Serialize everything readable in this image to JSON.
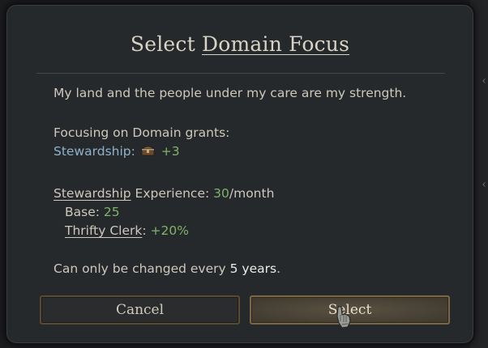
{
  "dialog": {
    "title_prefix": "Select",
    "title_focus": "Domain Focus",
    "description": "My land and the people under my care are my strength.",
    "grants_heading": "Focusing on Domain grants:",
    "grant_skill": "Stewardship",
    "grant_colon": ":",
    "grant_value": "+3",
    "experience": {
      "skill": "Stewardship",
      "label": " Experience: ",
      "value": "30",
      "unit": "/month"
    },
    "base": {
      "label": "Base: ",
      "value": "25"
    },
    "modifier": {
      "name": "Thrifty Clerk",
      "colon": ": ",
      "value": "+20%"
    },
    "change_note_prefix": "Can only be changed every ",
    "change_note_value": "5 years",
    "change_note_suffix": ".",
    "cancel_label": "Cancel",
    "select_label": "Select"
  },
  "icons": {
    "grant_icon": "treasure-chest-icon",
    "cursor": "gauntlet-cursor-icon"
  },
  "colors": {
    "skill_blue": "#8fb2c9",
    "positive_green": "#7fb36a",
    "button_border_gold": "#7e6640"
  }
}
